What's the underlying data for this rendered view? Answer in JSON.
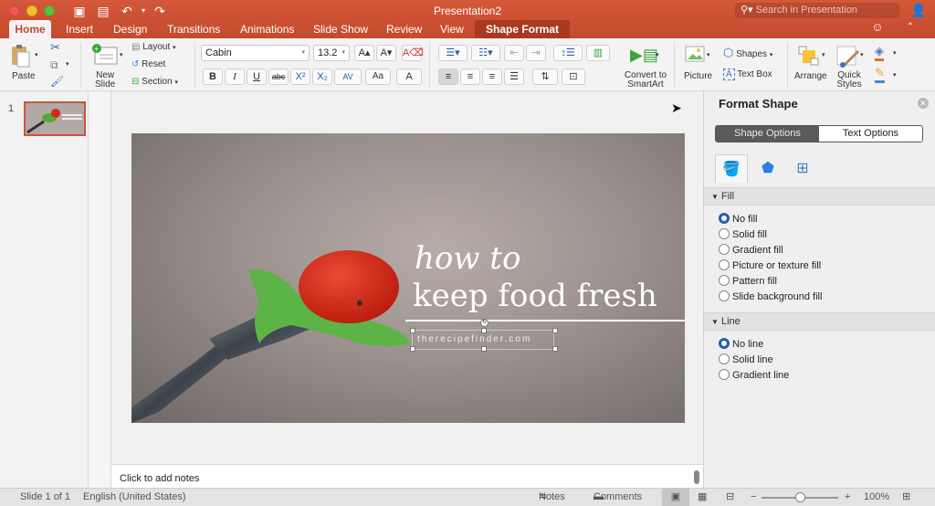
{
  "window": {
    "title": "Presentation2",
    "search_placeholder": "Search in Presentation"
  },
  "quick_access": [
    "sidebar-icon",
    "save-icon",
    "undo-icon",
    "redo-icon"
  ],
  "tabs": [
    {
      "label": "Home",
      "active": true
    },
    {
      "label": "Insert"
    },
    {
      "label": "Design"
    },
    {
      "label": "Transitions"
    },
    {
      "label": "Animations"
    },
    {
      "label": "Slide Show"
    },
    {
      "label": "Review"
    },
    {
      "label": "View"
    },
    {
      "label": "Shape Format",
      "contextual": true
    }
  ],
  "ribbon": {
    "paste": "Paste",
    "new_slide": "New\nSlide",
    "layout": "Layout",
    "reset": "Reset",
    "section": "Section",
    "font_name": "Cabin",
    "font_size": "13.2",
    "bold": "B",
    "italic": "I",
    "underline": "U",
    "strike": "abc",
    "superscript": "X²",
    "subscript": "X₂",
    "char_spacing": "AV",
    "change_case": "Aa",
    "font_color": "A",
    "grow_font": "A▴",
    "shrink_font": "A▾",
    "convert_smartart": "Convert to SmartArt",
    "picture": "Picture",
    "shapes": "Shapes",
    "text_box": "Text Box",
    "arrange": "Arrange",
    "quick_styles": "Quick Styles"
  },
  "thumbnails": [
    {
      "number": "1"
    }
  ],
  "slide": {
    "line1": "how to",
    "line2": "keep food fresh",
    "subtitle": "therecipefinder.com"
  },
  "notes": {
    "placeholder": "Click to add notes"
  },
  "format_panel": {
    "title": "Format Shape",
    "segments": [
      "Shape Options",
      "Text Options"
    ],
    "active_segment": "Shape Options",
    "icon_tabs": [
      "fill-line-icon",
      "effects-icon",
      "size-properties-icon"
    ],
    "fill": {
      "header": "Fill",
      "options": [
        "No fill",
        "Solid fill",
        "Gradient fill",
        "Picture or texture fill",
        "Pattern fill",
        "Slide background fill"
      ],
      "selected": "No fill"
    },
    "line": {
      "header": "Line",
      "options": [
        "No line",
        "Solid line",
        "Gradient line"
      ],
      "selected": "No line"
    }
  },
  "status_bar": {
    "slide_info": "Slide 1 of 1",
    "language": "English (United States)",
    "notes": "Notes",
    "comments": "Comments",
    "zoom": "100%",
    "zoom_fraction": 0.5
  },
  "colors": {
    "accent": "#c44a2e",
    "radio_selected": "#1f5fb5"
  }
}
